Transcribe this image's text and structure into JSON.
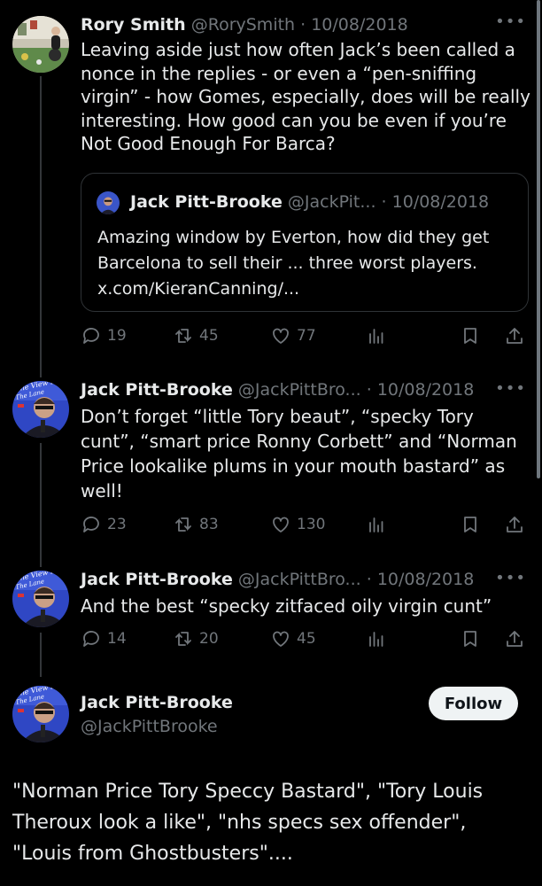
{
  "tweets": [
    {
      "name": "Rory Smith",
      "handle": "@RorySmith",
      "date": "10/08/2018",
      "lines": [
        "Leaving aside just how often Jack’s been called a",
        "nonce in the replies - or even a “pen-sniffing",
        "virgin” - how Gomes, especially, does will be really",
        "interesting. How good can you be even if you’re",
        "Not Good Enough For Barca?"
      ],
      "quote": {
        "name": "Jack Pitt-Brooke",
        "handle": "@JackPit...",
        "date": "10/08/2018",
        "lines": [
          "Amazing window by Everton, how did they get",
          "Barcelona to sell their ... three worst players.",
          "x.com/KieranCanning/..."
        ]
      },
      "replies": "19",
      "retweets": "45",
      "likes": "77"
    },
    {
      "name": "Jack Pitt-Brooke",
      "handle": "@JackPittBro...",
      "date": "10/08/2018",
      "lines": [
        "Don’t forget “little Tory beaut”, “specky Tory",
        "cunt”, “smart price Ronny Corbett” and “Norman",
        "Price lookalike plums in your mouth bastard” as",
        "well!"
      ],
      "replies": "23",
      "retweets": "83",
      "likes": "130"
    },
    {
      "name": "Jack Pitt-Brooke",
      "handle": "@JackPittBro...",
      "date": "10/08/2018",
      "lines": [
        "And the best “specky zitfaced oily virgin cunt”"
      ],
      "replies": "14",
      "retweets": "20",
      "likes": "45"
    }
  ],
  "main_tweet": {
    "name": "Jack Pitt-Brooke",
    "handle": "@JackPittBrooke",
    "follow_label": "Follow",
    "lines": [
      "\"Norman Price Tory Speccy Bastard\", \"Tory Louis",
      "Theroux look a like\", \"nhs specs sex offender\",",
      "\"Louis from Ghostbusters\"...."
    ]
  },
  "avatar_text": {
    "line1": "The View F",
    "line2": "The Lane"
  },
  "colors": {
    "background": "#000000",
    "text": "#e7e9ea",
    "muted": "#71767b",
    "border": "#2f3336",
    "follow_bg": "#eff3f4"
  },
  "icons": [
    "reply-icon",
    "retweet-icon",
    "like-icon",
    "views-icon",
    "bookmark-icon",
    "share-icon",
    "more-icon"
  ]
}
